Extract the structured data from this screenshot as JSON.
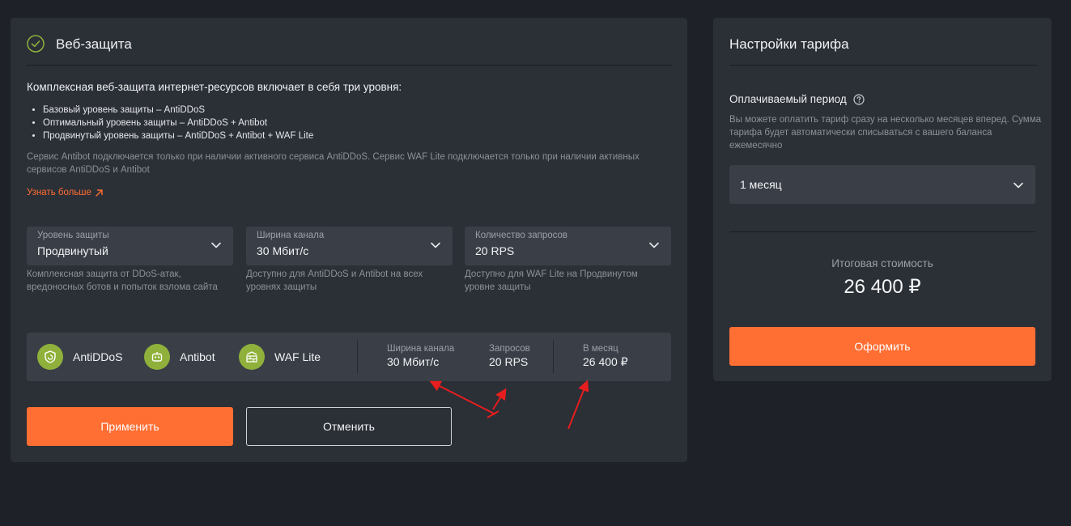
{
  "left": {
    "title": "Веб-защита",
    "intro": "Комплексная веб-защита интернет-ресурсов включает в себя три уровня:",
    "bullets": [
      "Базовый уровень защиты – AntiDDoS",
      "Оптимальный уровень защиты – AntiDDoS + Antibot",
      "Продвинутый уровень защиты – AntiDDoS + Antibot + WAF Lite"
    ],
    "note": "Сервис Antibot подключается только при наличии активного сервиса AntiDDoS. Сервис WAF Lite подключается только при наличии активных сервисов AntiDDoS и Antibot",
    "learn_more": "Узнать больше",
    "fields": [
      {
        "label": "Уровень защиты",
        "value": "Продвинутый",
        "hint": "Комплексная защита от DDoS-атак, вредоносных ботов и попыток взлома сайта"
      },
      {
        "label": "Ширина канала",
        "value": "30 Мбит/с",
        "hint": "Доступно для AntiDDoS и Antibot на всех уровнях защиты"
      },
      {
        "label": "Количество запросов",
        "value": "20 RPS",
        "hint": "Доступно для WAF Lite на Продвинутом уровне защиты"
      }
    ],
    "summary": {
      "services": [
        "AntiDDoS",
        "Antibot",
        "WAF Lite"
      ],
      "bandwidth_label": "Ширина канала",
      "bandwidth_value": "30 Мбит/с",
      "requests_label": "Запросов",
      "requests_value": "20 RPS",
      "monthly_label": "В месяц",
      "monthly_value": "26 400 ₽"
    },
    "apply_label": "Применить",
    "cancel_label": "Отменить"
  },
  "right": {
    "title": "Настройки тарифа",
    "period_label": "Оплачиваемый период",
    "period_note": "Вы можете оплатить тариф сразу на несколько месяцев вперед. Сумма тарифа будет автоматически списываться с вашего баланса ежемесячно",
    "period_value": "1 месяц",
    "total_label": "Итоговая стоимость",
    "total_value": "26 400 ₽",
    "order_label": "Оформить"
  },
  "colors": {
    "accent": "#ff6e33",
    "service_icon": "#8fb13b",
    "check": "#8fb13b",
    "annotation": "#e61e1e"
  }
}
